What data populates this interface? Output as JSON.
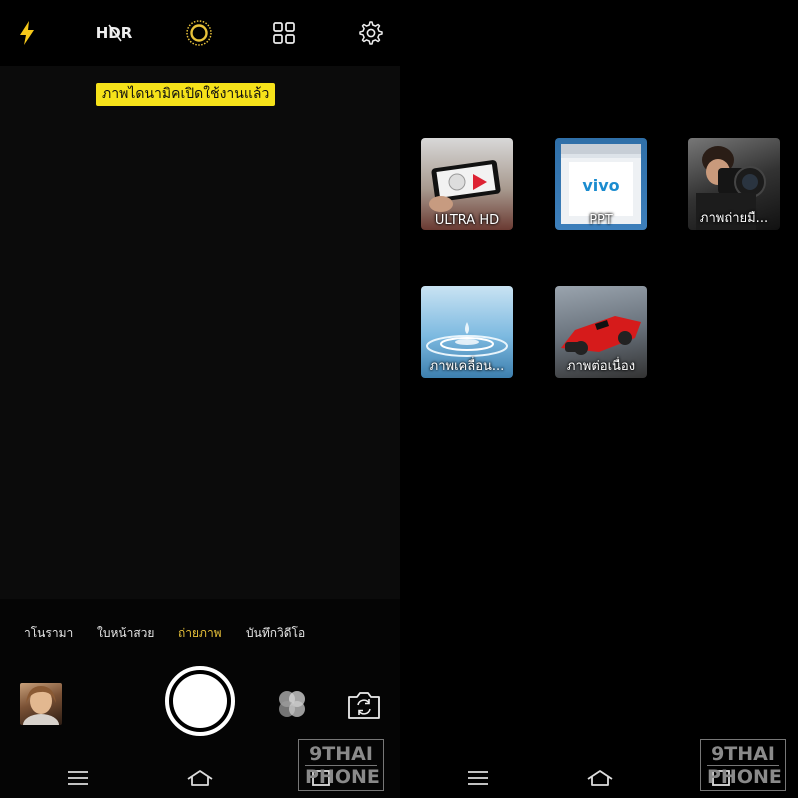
{
  "left_panel": {
    "topbar": {
      "flash_icon": "flash-icon",
      "hdr_label": "HDR",
      "live_icon": "live-photo-icon",
      "grid_icon": "grid-icon",
      "settings_icon": "gear-icon"
    },
    "dynamic_badge": "ภาพไดนามิคเปิดใช้งานแล้ว",
    "modes": [
      {
        "label": "าโนรามา",
        "active": false
      },
      {
        "label": "ใบหน้าสวย",
        "active": false
      },
      {
        "label": "ถ่ายภาพ",
        "active": true
      },
      {
        "label": "บันทึกวิดีโอ",
        "active": false
      }
    ],
    "controls": {
      "gallery_thumb": "gallery-thumbnail",
      "shutter": "shutter-button",
      "filter_icon": "filter-icon",
      "flip_icon": "switch-camera-icon"
    }
  },
  "right_panel": {
    "tiles": [
      {
        "label": "ULTRA HD"
      },
      {
        "label": "PPT"
      },
      {
        "label": "ภาพถ่ายมื..."
      },
      {
        "label": "ภาพเคลื่อน..."
      },
      {
        "label": "ภาพต่อเนื่อง"
      }
    ],
    "ppt_logo": "vivo"
  },
  "navbar": {
    "menu_icon": "menu-icon",
    "home_icon": "home-icon",
    "back_icon": "back-icon"
  },
  "watermark": {
    "line1": "9THAI",
    "line2": "PHONE"
  },
  "colors": {
    "accent": "#e8c23a",
    "badge": "#f6e21a",
    "flash": "#f6c81a"
  }
}
